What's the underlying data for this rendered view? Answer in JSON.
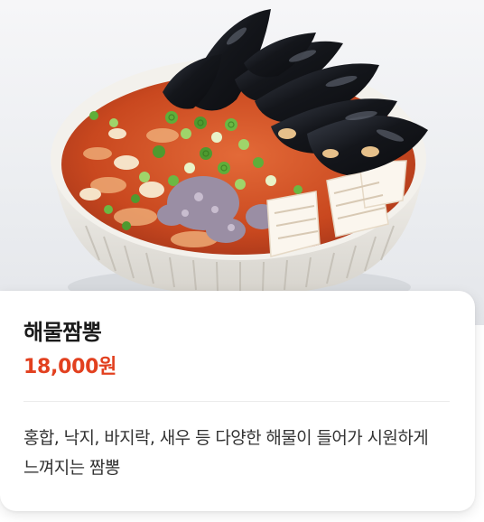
{
  "menu": {
    "name": "해물짬뽕",
    "price": "18,000원",
    "description": "홍합, 낙지, 바지락, 새우 등 다양한 해물이 들어가 시원하게 느껴지는 짬뽕"
  },
  "colors": {
    "price": "#e2401f",
    "broth": "#d9582d",
    "bowl": "#f1efea"
  }
}
